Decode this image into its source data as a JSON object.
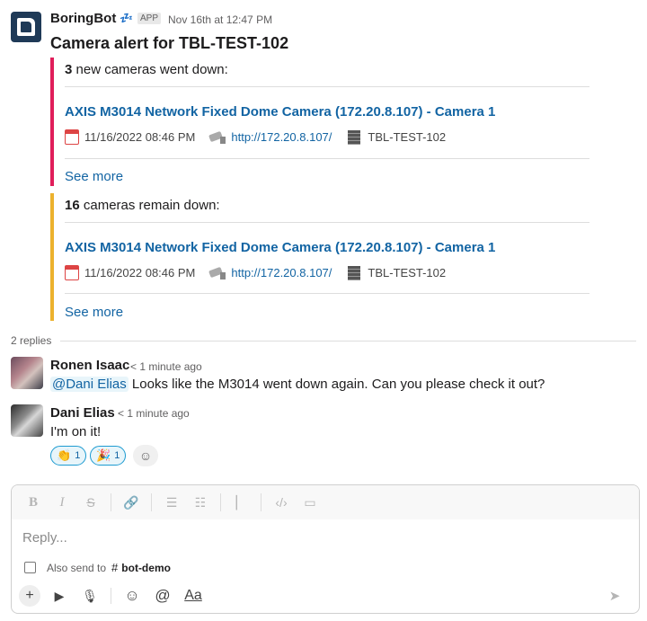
{
  "bot_message": {
    "sender": "BoringBot",
    "status_emoji": "💤",
    "badge": "APP",
    "timestamp": "Nov 16th at 12:47 PM",
    "title": "Camera alert for TBL-TEST-102",
    "attachments": [
      {
        "color": "#e01e5a",
        "heading_count": "3",
        "heading_text": "new cameras went down:",
        "camera_name": "AXIS M3014 Network Fixed Dome Camera (172.20.8.107) - Camera 1",
        "datetime": "11/16/2022 08:46 PM",
        "url": "http://172.20.8.107/",
        "host": "TBL-TEST-102",
        "see_more": "See more"
      },
      {
        "color": "#ecb22e",
        "heading_count": "16",
        "heading_text": "cameras remain down:",
        "camera_name": "AXIS M3014 Network Fixed Dome Camera (172.20.8.107) - Camera 1",
        "datetime": "11/16/2022 08:46 PM",
        "url": "http://172.20.8.107/",
        "host": "TBL-TEST-102",
        "see_more": "See more"
      }
    ]
  },
  "thread": {
    "replies_count": "2 replies",
    "replies": [
      {
        "sender": "Ronen Isaac",
        "time": "< 1 minute ago",
        "mention": "@Dani Elias",
        "text": " Looks like the M3014 went down again.  Can you please check it out?"
      },
      {
        "sender": "Dani Elias",
        "time": "< 1 minute ago",
        "text": "I'm on it!"
      }
    ],
    "reactions": [
      {
        "emoji": "👏",
        "count": "1"
      },
      {
        "emoji": "🎉",
        "count": "1"
      }
    ]
  },
  "composer": {
    "placeholder": "Reply...",
    "also_send_label": "Also send to",
    "channel_hash": "#",
    "channel_name": "bot-demo",
    "format_aa": "Aa"
  }
}
